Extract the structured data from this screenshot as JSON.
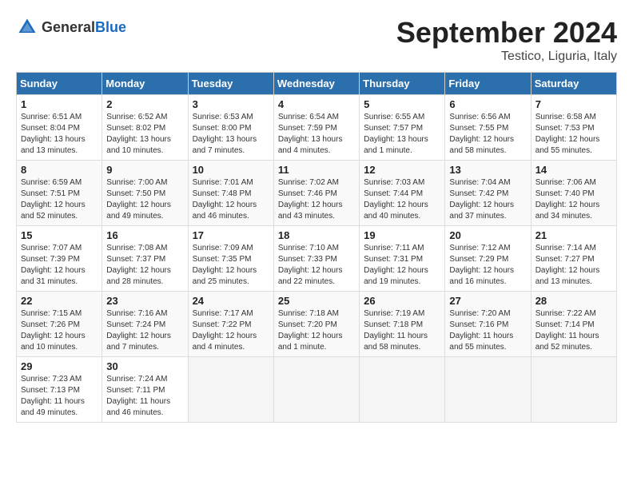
{
  "header": {
    "logo_general": "General",
    "logo_blue": "Blue",
    "month_title": "September 2024",
    "location": "Testico, Liguria, Italy"
  },
  "weekdays": [
    "Sunday",
    "Monday",
    "Tuesday",
    "Wednesday",
    "Thursday",
    "Friday",
    "Saturday"
  ],
  "weeks": [
    [
      {
        "day": "1",
        "info": "Sunrise: 6:51 AM\nSunset: 8:04 PM\nDaylight: 13 hours\nand 13 minutes."
      },
      {
        "day": "2",
        "info": "Sunrise: 6:52 AM\nSunset: 8:02 PM\nDaylight: 13 hours\nand 10 minutes."
      },
      {
        "day": "3",
        "info": "Sunrise: 6:53 AM\nSunset: 8:00 PM\nDaylight: 13 hours\nand 7 minutes."
      },
      {
        "day": "4",
        "info": "Sunrise: 6:54 AM\nSunset: 7:59 PM\nDaylight: 13 hours\nand 4 minutes."
      },
      {
        "day": "5",
        "info": "Sunrise: 6:55 AM\nSunset: 7:57 PM\nDaylight: 13 hours\nand 1 minute."
      },
      {
        "day": "6",
        "info": "Sunrise: 6:56 AM\nSunset: 7:55 PM\nDaylight: 12 hours\nand 58 minutes."
      },
      {
        "day": "7",
        "info": "Sunrise: 6:58 AM\nSunset: 7:53 PM\nDaylight: 12 hours\nand 55 minutes."
      }
    ],
    [
      {
        "day": "8",
        "info": "Sunrise: 6:59 AM\nSunset: 7:51 PM\nDaylight: 12 hours\nand 52 minutes."
      },
      {
        "day": "9",
        "info": "Sunrise: 7:00 AM\nSunset: 7:50 PM\nDaylight: 12 hours\nand 49 minutes."
      },
      {
        "day": "10",
        "info": "Sunrise: 7:01 AM\nSunset: 7:48 PM\nDaylight: 12 hours\nand 46 minutes."
      },
      {
        "day": "11",
        "info": "Sunrise: 7:02 AM\nSunset: 7:46 PM\nDaylight: 12 hours\nand 43 minutes."
      },
      {
        "day": "12",
        "info": "Sunrise: 7:03 AM\nSunset: 7:44 PM\nDaylight: 12 hours\nand 40 minutes."
      },
      {
        "day": "13",
        "info": "Sunrise: 7:04 AM\nSunset: 7:42 PM\nDaylight: 12 hours\nand 37 minutes."
      },
      {
        "day": "14",
        "info": "Sunrise: 7:06 AM\nSunset: 7:40 PM\nDaylight: 12 hours\nand 34 minutes."
      }
    ],
    [
      {
        "day": "15",
        "info": "Sunrise: 7:07 AM\nSunset: 7:39 PM\nDaylight: 12 hours\nand 31 minutes."
      },
      {
        "day": "16",
        "info": "Sunrise: 7:08 AM\nSunset: 7:37 PM\nDaylight: 12 hours\nand 28 minutes."
      },
      {
        "day": "17",
        "info": "Sunrise: 7:09 AM\nSunset: 7:35 PM\nDaylight: 12 hours\nand 25 minutes."
      },
      {
        "day": "18",
        "info": "Sunrise: 7:10 AM\nSunset: 7:33 PM\nDaylight: 12 hours\nand 22 minutes."
      },
      {
        "day": "19",
        "info": "Sunrise: 7:11 AM\nSunset: 7:31 PM\nDaylight: 12 hours\nand 19 minutes."
      },
      {
        "day": "20",
        "info": "Sunrise: 7:12 AM\nSunset: 7:29 PM\nDaylight: 12 hours\nand 16 minutes."
      },
      {
        "day": "21",
        "info": "Sunrise: 7:14 AM\nSunset: 7:27 PM\nDaylight: 12 hours\nand 13 minutes."
      }
    ],
    [
      {
        "day": "22",
        "info": "Sunrise: 7:15 AM\nSunset: 7:26 PM\nDaylight: 12 hours\nand 10 minutes."
      },
      {
        "day": "23",
        "info": "Sunrise: 7:16 AM\nSunset: 7:24 PM\nDaylight: 12 hours\nand 7 minutes."
      },
      {
        "day": "24",
        "info": "Sunrise: 7:17 AM\nSunset: 7:22 PM\nDaylight: 12 hours\nand 4 minutes."
      },
      {
        "day": "25",
        "info": "Sunrise: 7:18 AM\nSunset: 7:20 PM\nDaylight: 12 hours\nand 1 minute."
      },
      {
        "day": "26",
        "info": "Sunrise: 7:19 AM\nSunset: 7:18 PM\nDaylight: 11 hours\nand 58 minutes."
      },
      {
        "day": "27",
        "info": "Sunrise: 7:20 AM\nSunset: 7:16 PM\nDaylight: 11 hours\nand 55 minutes."
      },
      {
        "day": "28",
        "info": "Sunrise: 7:22 AM\nSunset: 7:14 PM\nDaylight: 11 hours\nand 52 minutes."
      }
    ],
    [
      {
        "day": "29",
        "info": "Sunrise: 7:23 AM\nSunset: 7:13 PM\nDaylight: 11 hours\nand 49 minutes."
      },
      {
        "day": "30",
        "info": "Sunrise: 7:24 AM\nSunset: 7:11 PM\nDaylight: 11 hours\nand 46 minutes."
      },
      {
        "day": "",
        "info": "",
        "empty": true
      },
      {
        "day": "",
        "info": "",
        "empty": true
      },
      {
        "day": "",
        "info": "",
        "empty": true
      },
      {
        "day": "",
        "info": "",
        "empty": true
      },
      {
        "day": "",
        "info": "",
        "empty": true
      }
    ]
  ]
}
